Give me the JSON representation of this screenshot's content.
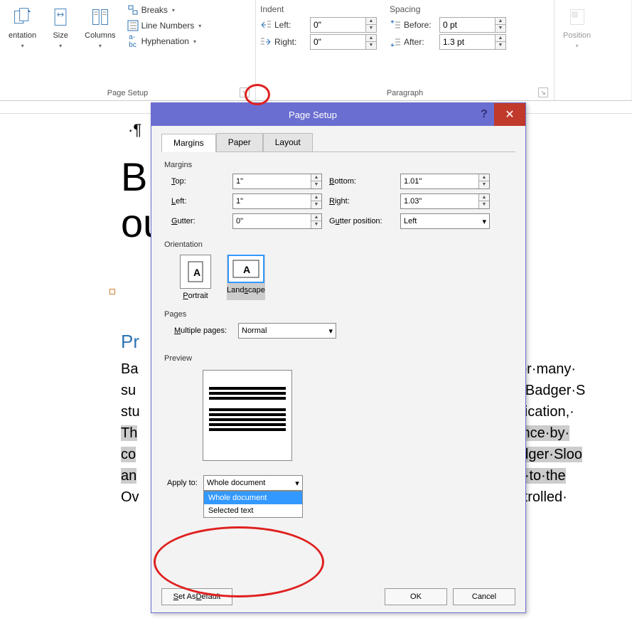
{
  "ribbon": {
    "pageSetup": {
      "label": "Page Setup",
      "orientation": "entation",
      "size": "Size",
      "columns": "Columns",
      "breaks": "Breaks",
      "lineNumbers": "Line Numbers",
      "hyphenation": "Hyphenation"
    },
    "paragraph": {
      "label": "Paragraph",
      "indentLabel": "Indent",
      "spacingLabel": "Spacing",
      "left": "Left:",
      "right": "Right:",
      "before": "Before:",
      "after": "After:",
      "leftVal": "0\"",
      "rightVal": "0\"",
      "beforeVal": "0 pt",
      "afterVal": "1.3 pt"
    },
    "position": "Position"
  },
  "dialog": {
    "title": "Page Setup",
    "tabs": {
      "margins": "Margins",
      "paper": "Paper",
      "layout": "Layout"
    },
    "margins": {
      "section": "Margins",
      "top": "Top:",
      "topVal": "1\"",
      "bottom": "Bottom:",
      "bottomVal": "1.01\"",
      "left": "Left:",
      "leftVal": "1\"",
      "right": "Right:",
      "rightVal": "1.03\"",
      "gutter": "Gutter:",
      "gutterVal": "0\"",
      "gutterPos": "Gutter position:",
      "gutterPosVal": "Left"
    },
    "orientation": {
      "section": "Orientation",
      "portrait": "Portrait",
      "landscape": "Landscape"
    },
    "pages": {
      "section": "Pages",
      "multiple": "Multiple pages:",
      "multipleVal": "Normal"
    },
    "preview": {
      "section": "Preview"
    },
    "applyTo": {
      "label": "Apply to:",
      "value": "Whole document",
      "options": [
        "Whole document",
        "Selected text"
      ]
    },
    "buttons": {
      "setDefault": "Set As Default",
      "ok": "OK",
      "cancel": "Cancel"
    }
  },
  "document": {
    "titleFragmentLeft": "B",
    "titleFragmentRight": "ous¶",
    "subhead": "Pr",
    "body1Left": "Ba",
    "body1Right": "for·many·",
    "body2Right": "n·Badger·S",
    "body2Left": "su",
    "body3Left": "stu",
    "body3Right": "nication,·",
    "body4Left": "Th",
    "body4Right": "ence·by·",
    "body5Left": "co",
    "body5Right": "adger·Sloo",
    "body6Left": "an",
    "body6Right": "le·to·the",
    "body7Left": "Ov",
    "body7Right": "ntrolled·"
  }
}
